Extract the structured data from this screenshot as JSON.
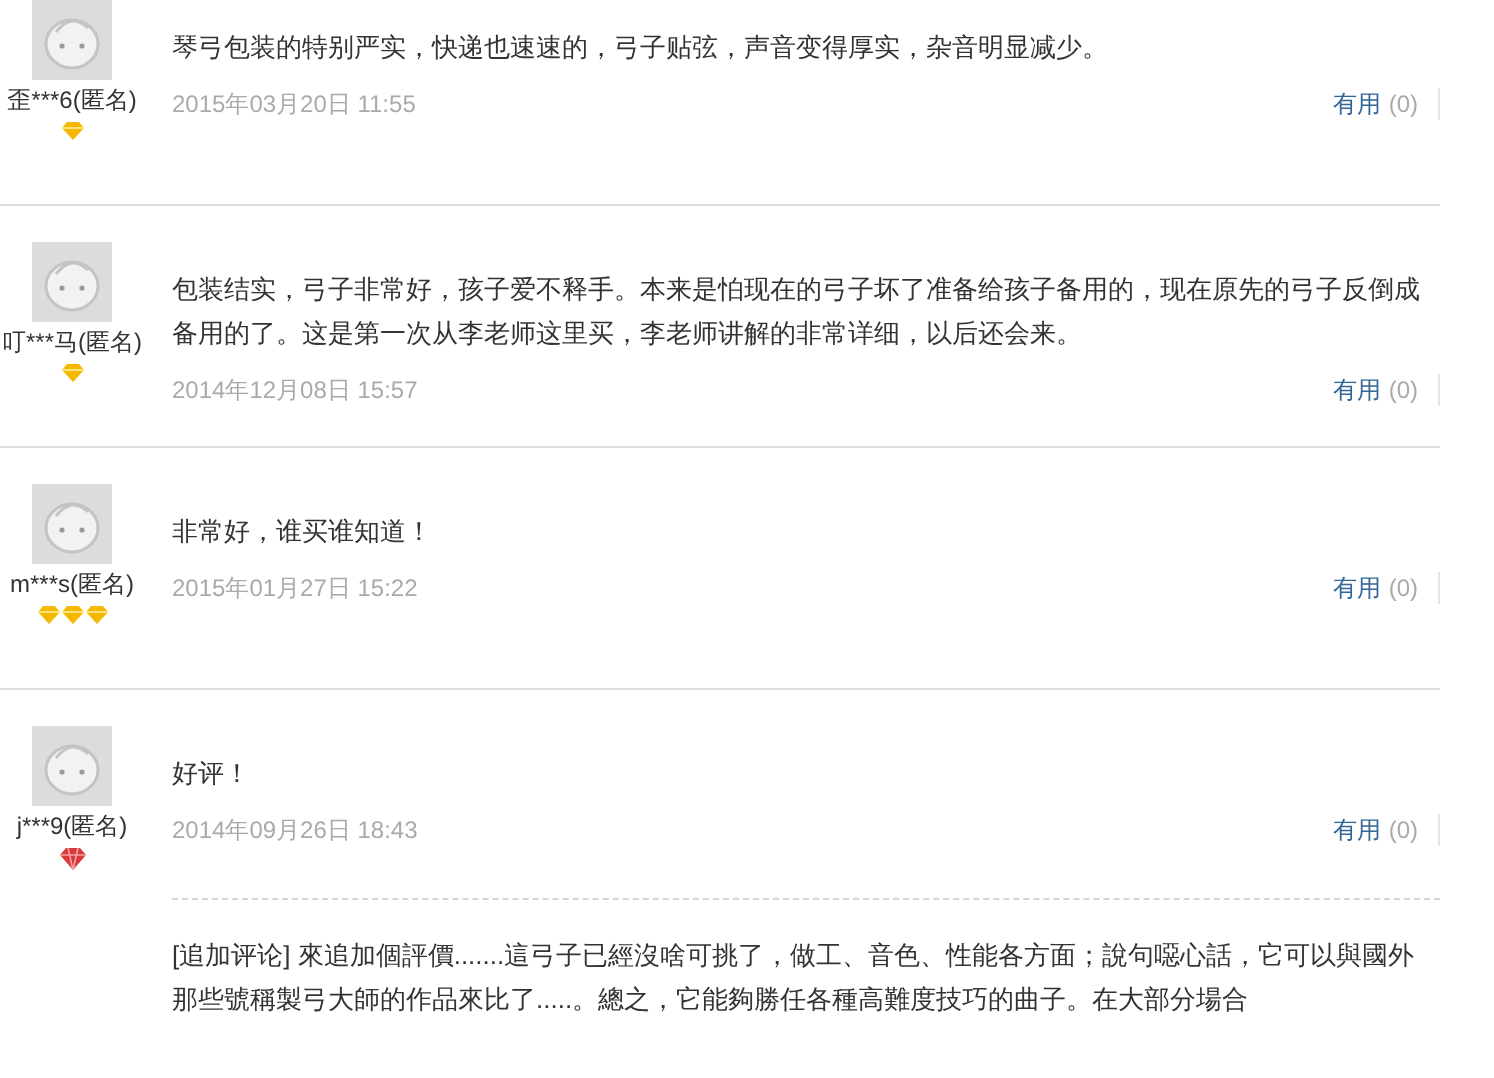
{
  "reviews": [
    {
      "user": "歪***6(匿名)",
      "badges": [
        {
          "kind": "gold"
        }
      ],
      "text": "琴弓包装的特别严实，快递也速速的，弓子贴弦，声音变得厚实，杂音明显减少。",
      "date": "2015年03月20日 11:55",
      "useful_label": "有用",
      "useful_count": "(0)"
    },
    {
      "user": "叮***马(匿名)",
      "badges": [
        {
          "kind": "gold"
        }
      ],
      "text": "包装结实，弓子非常好，孩子爱不释手。本来是怕现在的弓子坏了准备给孩子备用的，现在原先的弓子反倒成备用的了。这是第一次从李老师这里买，李老师讲解的非常详细，以后还会来。",
      "date": "2014年12月08日 15:57",
      "useful_label": "有用",
      "useful_count": "(0)"
    },
    {
      "user": "m***s(匿名)",
      "badges": [
        {
          "kind": "gold"
        },
        {
          "kind": "gold"
        },
        {
          "kind": "gold"
        }
      ],
      "text": "非常好，谁买谁知道！",
      "date": "2015年01月27日 15:22",
      "useful_label": "有用",
      "useful_count": "(0)"
    },
    {
      "user": "j***9(匿名)",
      "badges": [
        {
          "kind": "red"
        }
      ],
      "text": "好评！",
      "date": "2014年09月26日 18:43",
      "useful_label": "有用",
      "useful_count": "(0)",
      "append": "[追加评论] 來追加個評價.......這弓子已經沒啥可挑了，做工、音色、性能各方面；說句噁心話，它可以與國外那些號稱製弓大師的作品來比了.....。總之，它能夠勝任各種高難度技巧的曲子。在大部分場合"
    }
  ]
}
